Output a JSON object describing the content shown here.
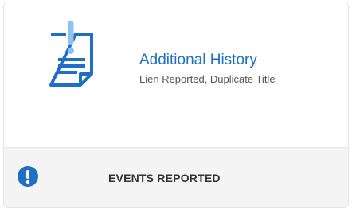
{
  "card": {
    "title": "Additional History",
    "subtitle": "Lien Reported, Duplicate Title",
    "icon": "document-alert-icon",
    "footer": {
      "label": "EVENTS REPORTED",
      "icon": "exclamation-circle-icon"
    }
  },
  "colors": {
    "accent": "#1f6fc5",
    "icon_light": "#8ec3f0",
    "footer_bg": "#f4f4f4"
  }
}
